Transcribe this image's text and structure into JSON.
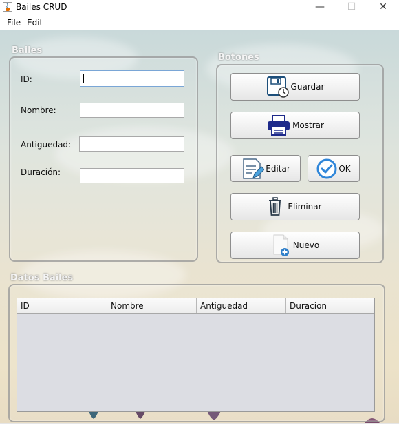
{
  "window": {
    "title": "Bailes CRUD",
    "minimize": "—",
    "maximize": "☐",
    "close": "✕"
  },
  "menu": {
    "file": "File",
    "edit": "Edit"
  },
  "form": {
    "title": "Bailes",
    "fields": [
      {
        "label": "ID:",
        "value": ""
      },
      {
        "label": "Nombre:",
        "value": ""
      },
      {
        "label": "Antiguedad:",
        "value": ""
      },
      {
        "label": "Duración:",
        "value": ""
      }
    ]
  },
  "buttons": {
    "title": "Botones",
    "guardar": "Guardar",
    "mostrar": "Mostrar",
    "editar": "Editar",
    "ok": "OK",
    "eliminar": "Eliminar",
    "nuevo": "Nuevo"
  },
  "table": {
    "title": "Datos Bailes",
    "columns": [
      "ID",
      "Nombre",
      "Antiguedad",
      "Duracion"
    ],
    "rows": []
  },
  "icons": {
    "app": "java-cup-icon",
    "guardar": "floppy-clock-icon",
    "mostrar": "printer-icon",
    "editar": "document-pencil-icon",
    "ok": "checkmark-circle-icon",
    "eliminar": "trash-icon",
    "nuevo": "new-document-plus-icon"
  }
}
